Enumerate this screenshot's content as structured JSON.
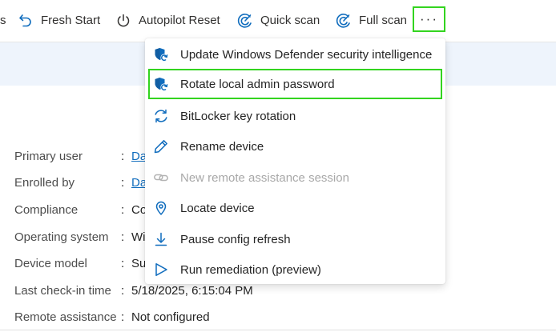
{
  "toolbar": {
    "partial_label": "s",
    "fresh_start": "Fresh Start",
    "autopilot_reset": "Autopilot Reset",
    "quick_scan": "Quick scan",
    "full_scan": "Full scan",
    "more": "···"
  },
  "properties": [
    {
      "name": "Primary user",
      "value": "Da",
      "link": true
    },
    {
      "name": "Enrolled by",
      "value": "Da",
      "link": true
    },
    {
      "name": "Compliance",
      "value": "Co",
      "link": false
    },
    {
      "name": "Operating system",
      "value": "Wi",
      "link": false
    },
    {
      "name": "Device model",
      "value": "Su",
      "link": false
    },
    {
      "name": "Last check-in time",
      "value": "5/18/2025, 6:15:04 PM",
      "link": false
    },
    {
      "name": "Remote assistance",
      "value": "Not configured",
      "link": false
    }
  ],
  "menu": {
    "items": [
      {
        "label": "Update Windows Defender security intelligence",
        "icon": "shield-refresh-icon",
        "enabled": true,
        "selected": false
      },
      {
        "label": "Rotate local admin password",
        "icon": "shield-refresh-icon",
        "enabled": true,
        "selected": true
      },
      {
        "label": "BitLocker key rotation",
        "icon": "rotate-arrows-icon",
        "enabled": true,
        "selected": false
      },
      {
        "label": "Rename device",
        "icon": "pencil-icon",
        "enabled": true,
        "selected": false
      },
      {
        "label": "New remote assistance session",
        "icon": "link-icon",
        "enabled": false,
        "selected": false
      },
      {
        "label": "Locate device",
        "icon": "location-pin-icon",
        "enabled": true,
        "selected": false
      },
      {
        "label": "Pause config refresh",
        "icon": "download-arrow-icon",
        "enabled": true,
        "selected": false
      },
      {
        "label": "Run remediation (preview)",
        "icon": "play-icon",
        "enabled": true,
        "selected": false
      }
    ]
  },
  "colors": {
    "accent": "#0f6cbd",
    "highlight": "#33d41f",
    "banner": "#eef4fc",
    "disabled": "#a8a8a8"
  }
}
